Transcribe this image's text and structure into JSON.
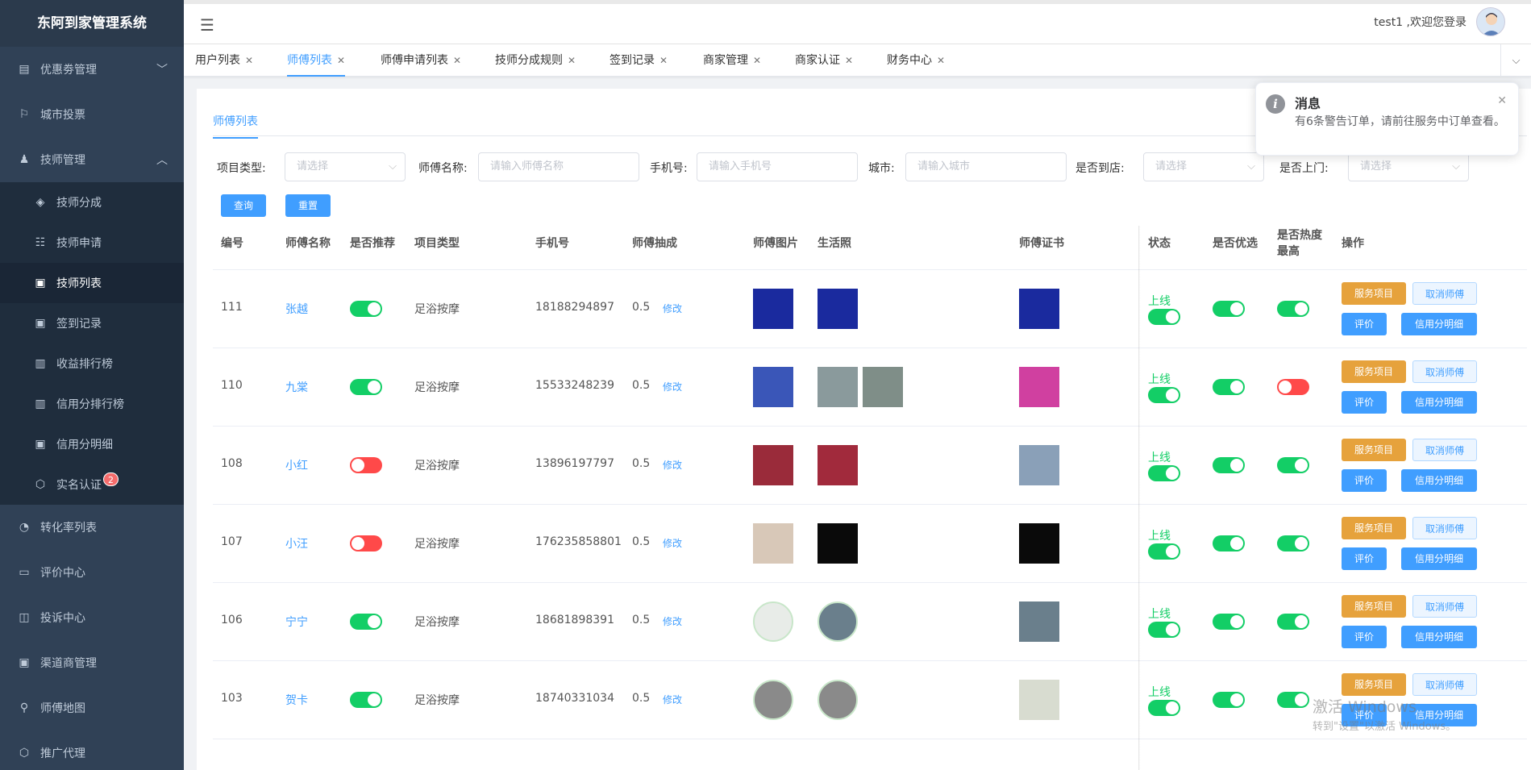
{
  "app": {
    "title": "东阿到家管理系统"
  },
  "sidebar": {
    "items": [
      {
        "label": "优惠劵管理",
        "icon": "coupon-icon",
        "expand": "down"
      },
      {
        "label": "城市投票",
        "icon": "vote-icon"
      },
      {
        "label": "技师管理",
        "icon": "technician-icon",
        "expand": "up"
      }
    ],
    "subitems": [
      {
        "label": "技师分成",
        "icon": "layers-icon"
      },
      {
        "label": "技师申请",
        "icon": "list-icon"
      },
      {
        "label": "技师列表",
        "icon": "table-icon",
        "active": true
      },
      {
        "label": "签到记录",
        "icon": "table-icon"
      },
      {
        "label": "收益排行榜",
        "icon": "bar-chart-icon"
      },
      {
        "label": "信用分排行榜",
        "icon": "bar-chart-icon"
      },
      {
        "label": "信用分明细",
        "icon": "table-icon"
      },
      {
        "label": "实名认证",
        "icon": "box-icon",
        "badge": "2"
      }
    ],
    "bottom": [
      {
        "label": "转化率列表",
        "icon": "pie-icon"
      },
      {
        "label": "评价中心",
        "icon": "comment-icon"
      },
      {
        "label": "投诉中心",
        "icon": "inbox-icon"
      },
      {
        "label": "渠道商管理",
        "icon": "table-icon"
      },
      {
        "label": "师傅地图",
        "icon": "location-icon"
      },
      {
        "label": "推广代理",
        "icon": "box-icon"
      }
    ]
  },
  "header": {
    "user_text": "test1 ,欢迎您登录"
  },
  "tabs": [
    {
      "label": "用户列表"
    },
    {
      "label": "师傅列表",
      "active": true
    },
    {
      "label": "师傅申请列表"
    },
    {
      "label": "技师分成规则"
    },
    {
      "label": "签到记录"
    },
    {
      "label": "商家管理"
    },
    {
      "label": "商家认证"
    },
    {
      "label": "财务中心"
    }
  ],
  "page": {
    "tab": "师傅列表",
    "filters": {
      "project_type": {
        "label": "项目类型:",
        "placeholder": "请选择"
      },
      "name": {
        "label": "师傅名称:",
        "placeholder": "请输入师傅名称"
      },
      "phone": {
        "label": "手机号:",
        "placeholder": "请输入手机号"
      },
      "city": {
        "label": "城市:",
        "placeholder": "请输入城市"
      },
      "to_store": {
        "label": "是否到店:",
        "placeholder": "请选择"
      },
      "home_visit": {
        "label": "是否上门:",
        "placeholder": "请选择"
      }
    },
    "buttons": {
      "query": "查询",
      "reset": "重置"
    }
  },
  "table": {
    "headers": {
      "id": "编号",
      "name": "师傅名称",
      "recommend": "是否推荐",
      "type": "项目类型",
      "phone": "手机号",
      "commission": "师傅抽成",
      "photo": "师傅图片",
      "life": "生活照",
      "cert": "师傅证书",
      "status": "状态",
      "preferred": "是否优选",
      "hot": "是否热度最高",
      "ops": "操作"
    },
    "edit_label": "修改",
    "status_label": "上线",
    "op_labels": {
      "service": "服务项目",
      "cancel": "取消师傅",
      "review": "评价",
      "credit": "信用分明细"
    },
    "rows": [
      {
        "id": "111",
        "name": "张越",
        "recommend": true,
        "type": "足浴按摩",
        "phone": "18188294897",
        "commission": "0.5",
        "online": true,
        "preferred": true,
        "hot": true,
        "photo_color": "#1a2a9e",
        "life_colors": [
          "#1a2a9e"
        ],
        "cert_color": "#1a2a9e",
        "round": false
      },
      {
        "id": "110",
        "name": "九棠",
        "recommend": true,
        "type": "足浴按摩",
        "phone": "15533248239",
        "commission": "0.5",
        "online": true,
        "preferred": true,
        "hot": false,
        "photo_color": "#3a56b8",
        "life_colors": [
          "#8a9a9c",
          "#7f8e88"
        ],
        "cert_color": "#d040a0",
        "round": false
      },
      {
        "id": "108",
        "name": "小红",
        "recommend": false,
        "type": "足浴按摩",
        "phone": "13896197797",
        "commission": "0.5",
        "online": true,
        "preferred": true,
        "hot": true,
        "photo_color": "#9a2b3a",
        "life_colors": [
          "#a12a3c"
        ],
        "cert_color": "#8aa0b8",
        "round": false
      },
      {
        "id": "107",
        "name": "小汪",
        "recommend": false,
        "type": "足浴按摩",
        "phone": "176235858801",
        "commission": "0.5",
        "online": true,
        "preferred": true,
        "hot": true,
        "photo_color": "#d8c8b8",
        "life_colors": [
          "#0a0a0a"
        ],
        "cert_color": "#0a0a0a",
        "round": false
      },
      {
        "id": "106",
        "name": "宁宁",
        "recommend": true,
        "type": "足浴按摩",
        "phone": "18681898391",
        "commission": "0.5",
        "online": true,
        "preferred": true,
        "hot": true,
        "photo_color": "#e8ece8",
        "life_colors": [
          "#6a7f8c"
        ],
        "cert_color": "#6a7f8c",
        "round": true
      },
      {
        "id": "103",
        "name": "贺卡",
        "recommend": true,
        "type": "足浴按摩",
        "phone": "18740331034",
        "commission": "0.5",
        "online": true,
        "preferred": true,
        "hot": true,
        "photo_color": "#8a8a8a",
        "life_colors": [
          "#8a8a8a"
        ],
        "cert_color": "#d8dcd0",
        "round": true
      }
    ]
  },
  "notification": {
    "title": "消息",
    "message": "有6条警告订单，请前往服务中订单查看。"
  },
  "watermark": {
    "line1": "激活 Windows",
    "line2": "转到\"设置\"以激活 Windows。"
  }
}
